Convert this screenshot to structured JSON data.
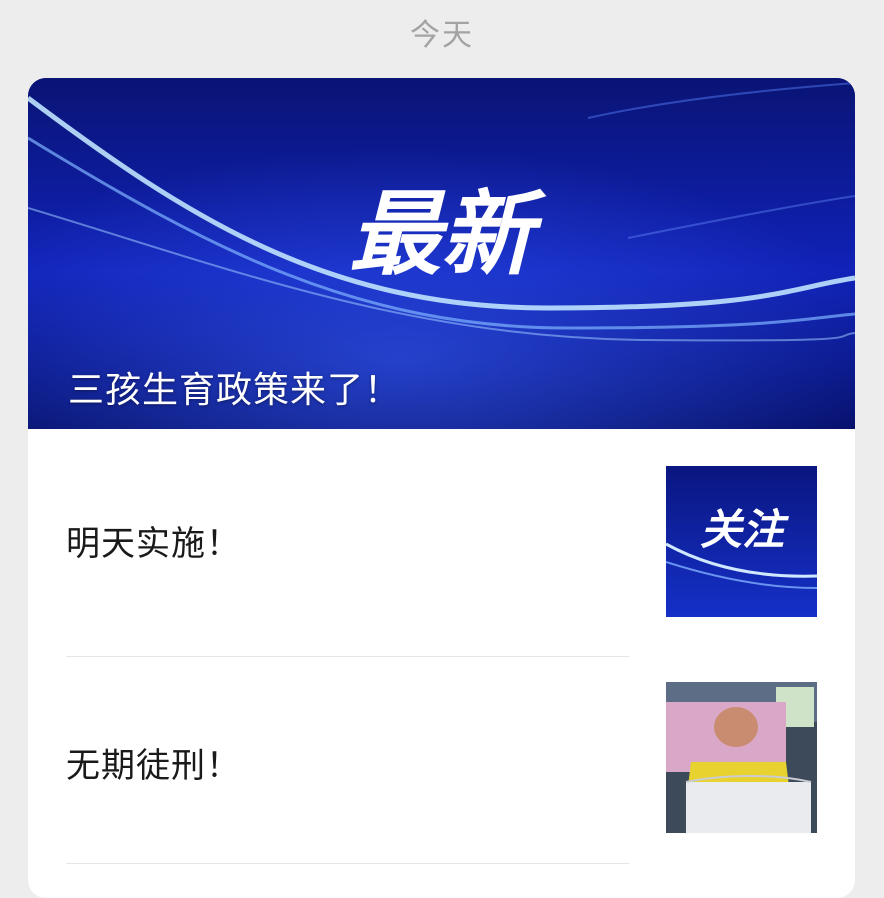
{
  "date_separator": "今天",
  "article": {
    "cover_badge": "最新",
    "cover_title": "三孩生育政策来了！",
    "sub_items": [
      {
        "title": "明天实施！",
        "thumb_badge": "关注"
      },
      {
        "title": "无期徒刑！",
        "thumb_kind": "photo"
      }
    ]
  },
  "colors": {
    "background": "#ededed",
    "card": "#ffffff",
    "cover_blue": "#0a1a8a",
    "title_text": "#1a1a1a",
    "date_text": "#a3a3a3"
  }
}
